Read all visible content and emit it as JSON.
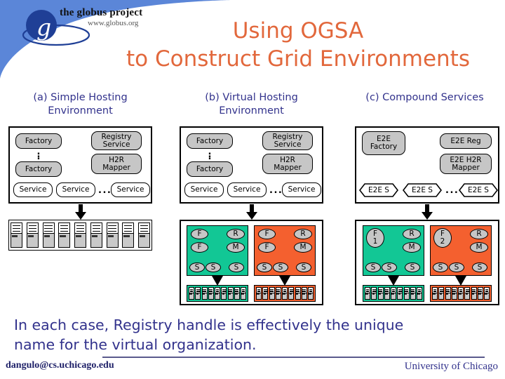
{
  "brand": {
    "line1": "the globus project",
    "line2": "www.globus.org",
    "logo_glyph": "g",
    "swoosh_color": "#5B86D8",
    "logo_circle_color": "#1F3F96"
  },
  "title": {
    "line1": "Using OGSA",
    "line2": "to Construct Grid Environments",
    "color": "#E2683C"
  },
  "columns": [
    {
      "id": "a",
      "caption_line1": "(a) Simple Hosting",
      "caption_line2": "Environment"
    },
    {
      "id": "b",
      "caption_line1": "(b) Virtual Hosting",
      "caption_line2": "Environment"
    },
    {
      "id": "c",
      "caption_line1": "(c) Compound Services",
      "caption_line2": ""
    }
  ],
  "caption_color": "#32328C",
  "diagram_a": {
    "upper_panel": {
      "factory_top": "Factory",
      "vertical_ellipsis": "⋮",
      "factory_bottom": "Factory",
      "registry_line1": "Registry",
      "registry_line2": "Service",
      "h2r_line1": "H2R",
      "h2r_line2": "Mapper",
      "services": [
        "Service",
        "Service",
        "Service"
      ],
      "service_ellipsis": "..."
    },
    "lower_panel": {
      "tower_count": 9
    }
  },
  "diagram_b": {
    "upper_panel": {
      "factory_top": "Factory",
      "vertical_ellipsis": "⋮",
      "factory_bottom": "Factory",
      "registry_line1": "Registry",
      "registry_line2": "Service",
      "h2r_line1": "H2R",
      "h2r_line2": "Mapper",
      "services": [
        "Service",
        "Service",
        "Service"
      ],
      "service_ellipsis": "..."
    },
    "vo_blocks": [
      {
        "color": "#12C795",
        "factory_1": "F",
        "factory_2": "F",
        "registry": "R",
        "mapper": "M",
        "services": [
          "S",
          "S",
          "S"
        ],
        "tower_count": 9
      },
      {
        "color": "#F4602F",
        "factory_1": "F",
        "factory_2": "F",
        "registry": "R",
        "mapper": "M",
        "services": [
          "S",
          "S",
          "S"
        ],
        "tower_count": 9
      }
    ]
  },
  "diagram_c": {
    "upper_panel": {
      "e2e_factory_line1": "E2E",
      "e2e_factory_line2": "Factory",
      "e2e_reg": "E2E Reg",
      "e2e_h2r_line1": "E2E H2R",
      "e2e_h2r_line2": "Mapper",
      "services": [
        "E2E S",
        "E2E S",
        "E2E S"
      ],
      "service_ellipsis": "..."
    },
    "vo_blocks": [
      {
        "color": "#12C795",
        "factory_line1": "F",
        "factory_line2": "1",
        "registry": "R",
        "mapper": "M",
        "services": [
          "S",
          "S",
          "S"
        ],
        "tower_count": 9
      },
      {
        "color": "#F4602F",
        "factory_line1": "F",
        "factory_line2": "2",
        "registry": "R",
        "mapper": "M",
        "services": [
          "S",
          "S",
          "S"
        ],
        "tower_count": 9
      }
    ]
  },
  "conclusion": {
    "line1": "In each case, Registry handle is effectively the unique",
    "line2": "name for the virtual organization.",
    "color": "#32328C"
  },
  "footer": {
    "left": "dangulo@cs.uchicago.edu",
    "right": "University of Chicago"
  }
}
